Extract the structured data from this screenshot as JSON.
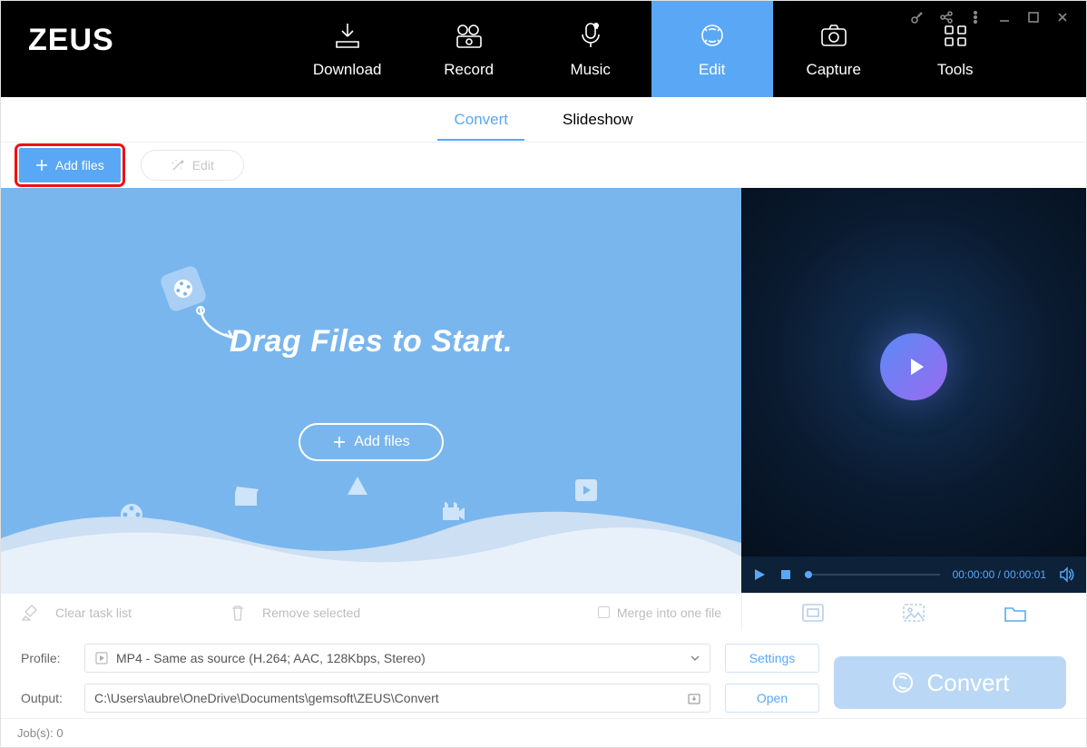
{
  "app": {
    "logo": "ZEUS"
  },
  "nav": {
    "items": [
      {
        "label": "Download"
      },
      {
        "label": "Record"
      },
      {
        "label": "Music"
      },
      {
        "label": "Edit",
        "active": true
      },
      {
        "label": "Capture"
      },
      {
        "label": "Tools"
      }
    ]
  },
  "subtabs": {
    "items": [
      {
        "label": "Convert",
        "active": true
      },
      {
        "label": "Slideshow"
      }
    ]
  },
  "toolbar": {
    "add_files": "Add files",
    "edit": "Edit"
  },
  "dropzone": {
    "title": "Drag Files to Start.",
    "add_files": "Add files"
  },
  "preview": {
    "time": "00:00:00 / 00:00:01"
  },
  "actions": {
    "clear": "Clear task list",
    "remove": "Remove selected",
    "merge": "Merge into one file"
  },
  "profile": {
    "label": "Profile:",
    "value": "MP4 - Same as source (H.264; AAC, 128Kbps, Stereo)",
    "settings": "Settings"
  },
  "output": {
    "label": "Output:",
    "value": "C:\\Users\\aubre\\OneDrive\\Documents\\gemsoft\\ZEUS\\Convert",
    "open": "Open"
  },
  "convert": {
    "label": "Convert"
  },
  "status": {
    "jobs": "Job(s): 0"
  }
}
